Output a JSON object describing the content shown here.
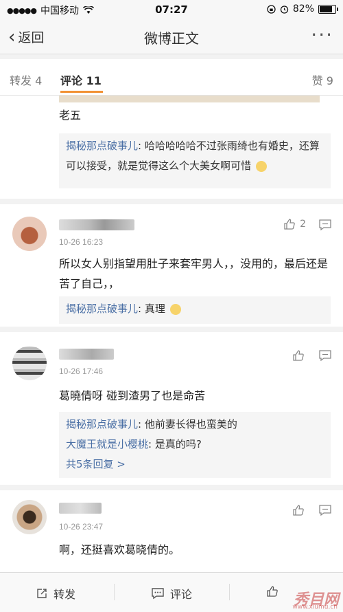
{
  "status_bar": {
    "carrier": "中国移动",
    "time": "07:27",
    "battery": "82%"
  },
  "nav": {
    "back_label": "返回",
    "title": "微博正文"
  },
  "tabs": {
    "repost": "转发 4",
    "comments": "评论 11",
    "likes": "赞 9",
    "accent_color": "#f29235"
  },
  "comments": [
    {
      "text_tail": "老五",
      "replies": [
        {
          "author": "揭秘那点破事儿",
          "text": ": 哈哈哈哈哈不过张雨绮也有婚史，还算可以接受，就是觉得这么个大美女啊可惜"
        }
      ]
    },
    {
      "time": "10-26 16:23",
      "likes": "2",
      "text": "所以女人别指望用肚子来套牢男人，，没用的，最后还是苦了自己，，",
      "replies": [
        {
          "author": "揭秘那点破事儿",
          "text": ": 真理"
        }
      ]
    },
    {
      "time": "10-26 17:46",
      "text": "葛曉倩呀 碰到渣男了也是命苦",
      "replies": [
        {
          "author": "揭秘那点破事儿",
          "text": ": 他前妻长得也蛮美的"
        },
        {
          "author": "大魔王就是小樱桃",
          "text": ": 是真的吗?"
        }
      ],
      "more_replies": "共5条回复 >"
    },
    {
      "time": "10-26 23:47",
      "text": "啊，还挺喜欢葛晓倩的。"
    }
  ],
  "bottom_bar": {
    "repost": "转发",
    "comment": "评论"
  },
  "watermark": {
    "text": "秀目网",
    "url": "www.xiumu.cn"
  },
  "link_color": "#4a6fa5"
}
